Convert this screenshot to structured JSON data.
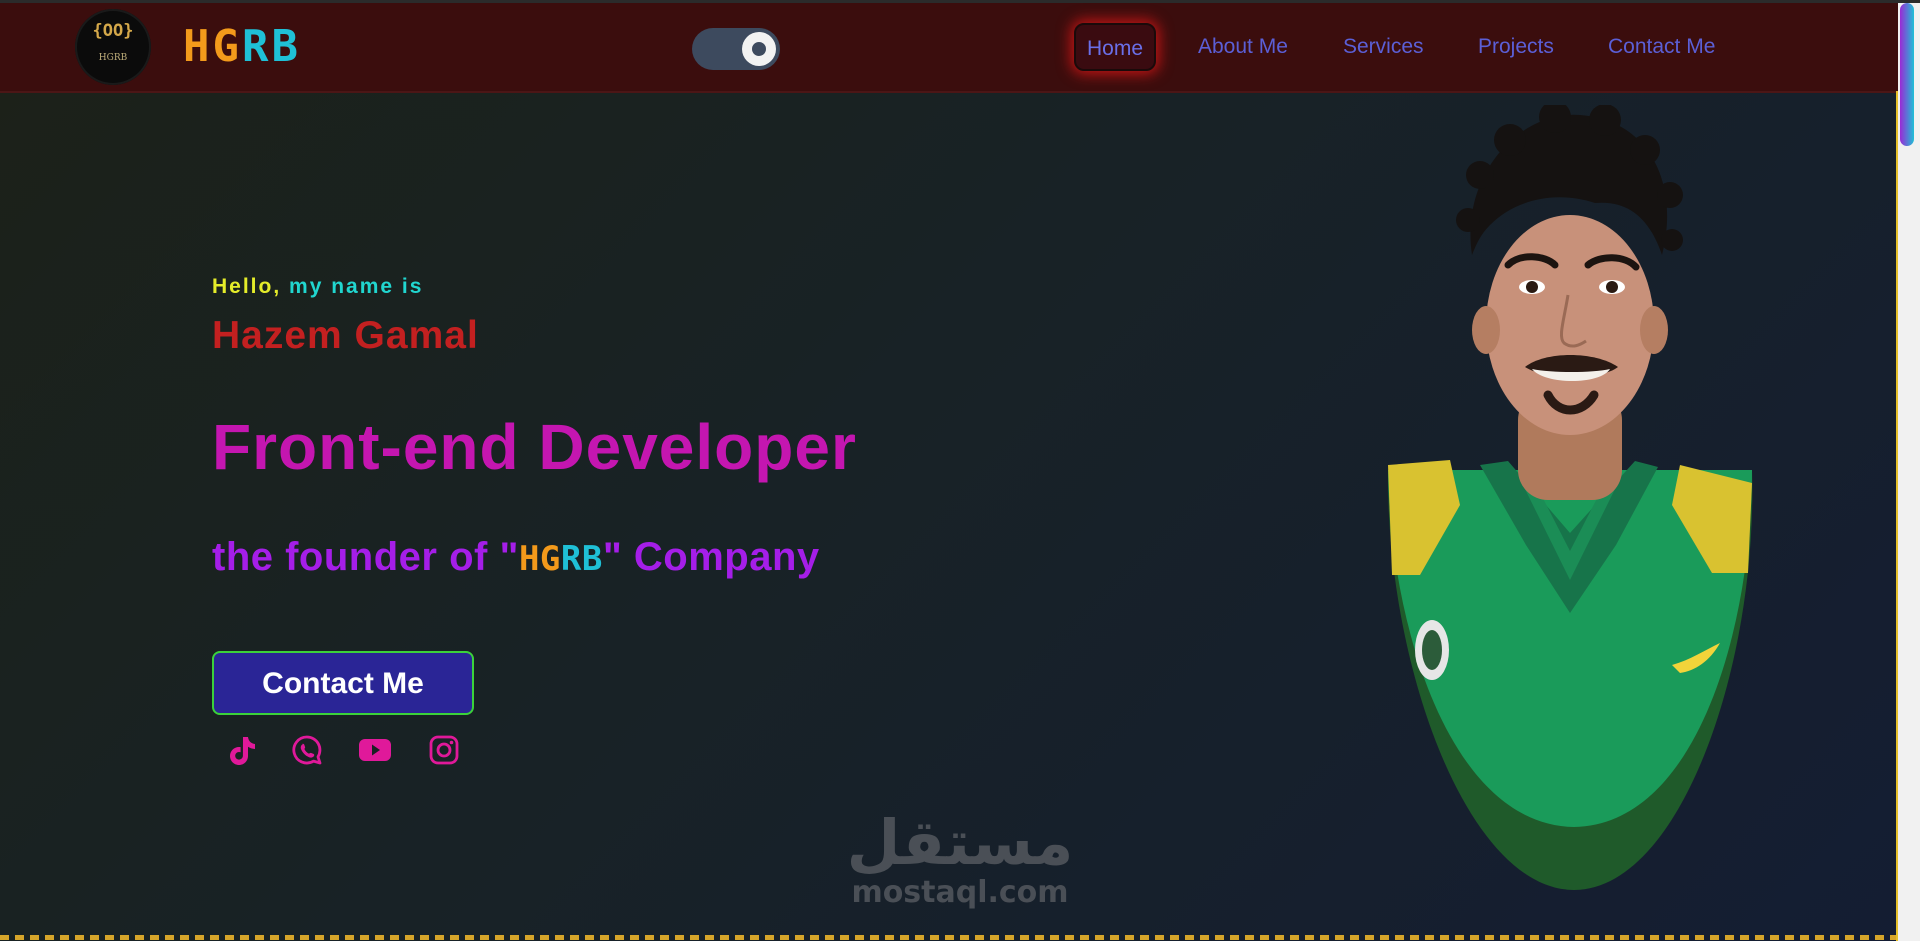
{
  "navbar": {
    "brand": {
      "part1": "HG",
      "part2": "RB"
    },
    "logo": {
      "braces": "{OO}",
      "mini_text": "HGRB"
    },
    "theme_toggle": {
      "state": "on"
    },
    "links": [
      {
        "label": "Home",
        "active": true
      },
      {
        "label": "About Me"
      },
      {
        "label": "Services"
      },
      {
        "label": "Projects"
      },
      {
        "label": "Contact Me"
      }
    ]
  },
  "hero": {
    "greeting_hello": "Hello,",
    "greeting_rest": " my name is",
    "name": "Hazem Gamal",
    "role": "Front-end Developer",
    "founder_prefix": "the founder of \"",
    "company_part1": "HG",
    "company_part2": "RB",
    "founder_suffix": "\" Company",
    "cta_label": "Contact Me",
    "socials": [
      {
        "icon": "tiktok-icon"
      },
      {
        "icon": "whatsapp-icon"
      },
      {
        "icon": "youtube-icon"
      },
      {
        "icon": "instagram-icon"
      }
    ]
  },
  "watermark": {
    "arabic": "مستقل",
    "latin": "mostaql.com"
  },
  "colors": {
    "nav_bg": "#3b0d0d",
    "link": "#5b5fd6",
    "accent_pink": "#e0199a",
    "brand_orange": "#f39a1b",
    "brand_cyan": "#1fc0d6",
    "cta_bg": "#2a2596"
  }
}
